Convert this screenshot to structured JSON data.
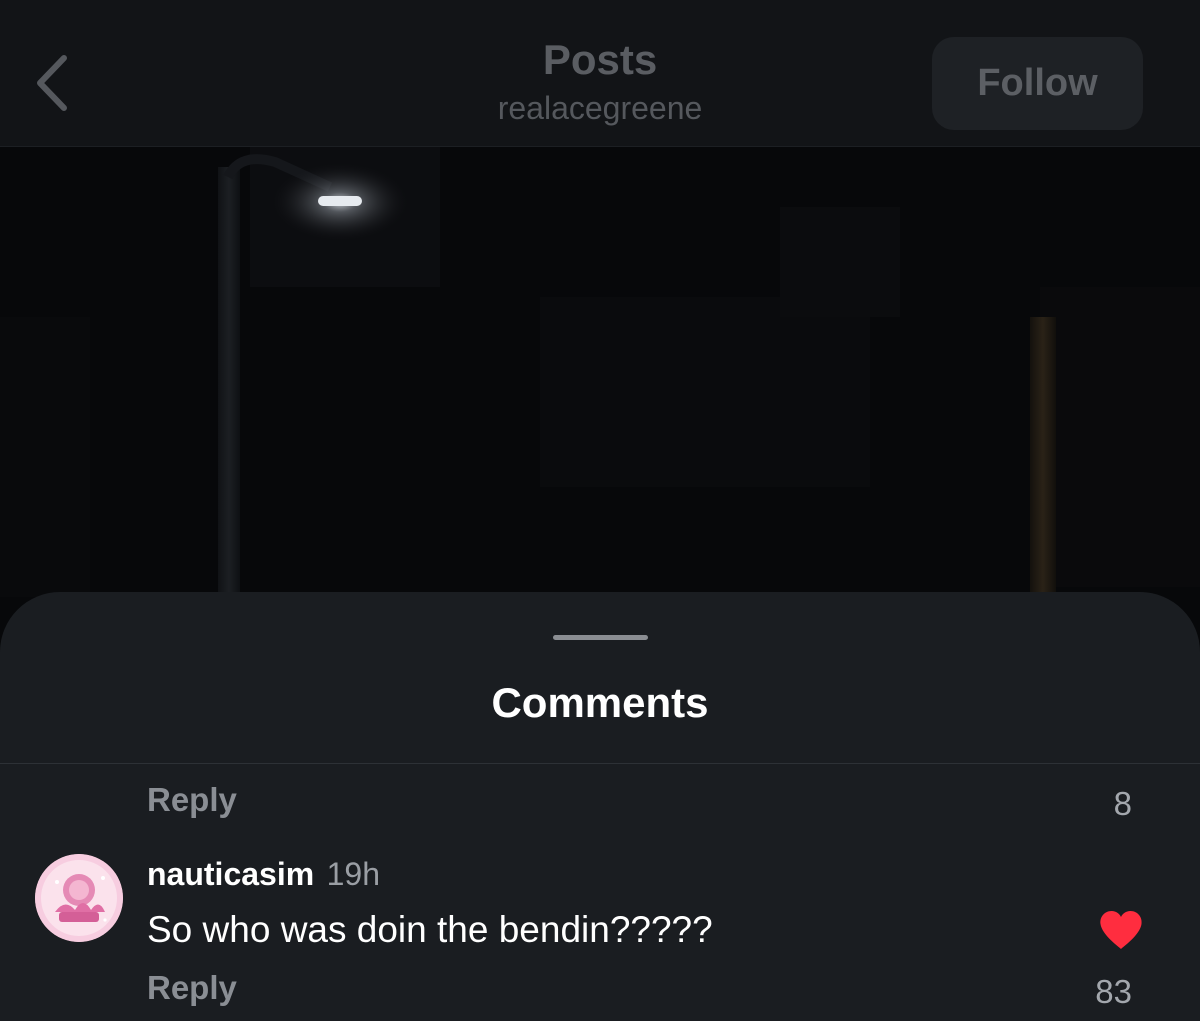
{
  "nav": {
    "back_icon": "chevron-left-icon",
    "title": "Posts",
    "subtitle": "realacegreene",
    "follow_label": "Follow"
  },
  "sheet": {
    "title": "Comments",
    "previous_comment": {
      "reply_label": "Reply",
      "like_count": "8"
    },
    "comments": [
      {
        "username": "nauticasim",
        "time": "19h",
        "text": "So who was doin the bendin?????",
        "reply_label": "Reply",
        "like_count": "83",
        "liked": true
      }
    ]
  },
  "colors": {
    "sheet_background": "#1a1d21",
    "like_red": "#ff2d3f",
    "primary_text": "#ffffff",
    "secondary_text": "#8a8e94"
  }
}
